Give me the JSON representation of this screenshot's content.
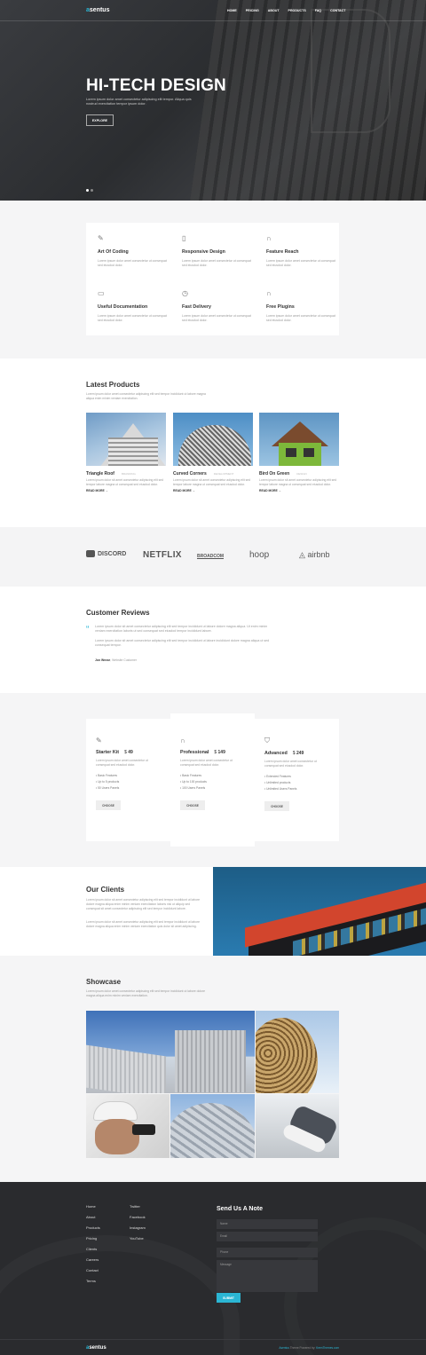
{
  "brand": {
    "logo_accent": "a",
    "logo_rest": "sentus",
    "accent_color": "#2bb6d4"
  },
  "nav": [
    "HOME",
    "PRICING",
    "ABOUT",
    "PRODUCTS",
    "FAQ",
    "CONTACT"
  ],
  "hero": {
    "title": "HI-TECH DESIGN",
    "text": "Lorem ipsum dolor amet consectetur adipiscing elit tempor. Aliqua quis nostrud exercitation tempor ipsum dolor.",
    "button": "EXPLORE"
  },
  "features": [
    {
      "icon": "pen-icon",
      "title": "Art Of Coding",
      "text": "Lorem ipsum dolor amet consectetur ut consequat sed eiusdod dolor."
    },
    {
      "icon": "mobile-icon",
      "title": "Responsive Design",
      "text": "Lorem ipsum dolor amet consectetur ut consequat sed eiusdod dolor."
    },
    {
      "icon": "headphones-icon",
      "title": "Feature Reach",
      "text": "Lorem ipsum dolor amet consectetur ut consequat sed eiusdod dolor."
    },
    {
      "icon": "book-icon",
      "title": "Useful Documentation",
      "text": "Lorem ipsum dolor amet consectetur ut consequat sed eiusdod dolor."
    },
    {
      "icon": "clock-icon",
      "title": "Fast Delivery",
      "text": "Lorem ipsum dolor amet consectetur ut consequat sed eiusdod dolor."
    },
    {
      "icon": "headset-icon",
      "title": "Free Plugins",
      "text": "Lorem ipsum dolor amet consectetur ut consequat sed eiusdod dolor."
    }
  ],
  "products": {
    "title": "Latest Products",
    "desc": "Lorem ipsum dolor amet consectetur adipiscing elit sed tempor incididunt ut labore magna aliqua enim minim veniam exercitation.",
    "items": [
      {
        "name": "Triangle Roof",
        "tag": "BRANDING",
        "text": "Lorem ipsum dolor sit amet consectetur adipiscing elit sed tempor labore magna ut consequat sed eiusdod dolor.",
        "more": "READ MORE →"
      },
      {
        "name": "Curved Corners",
        "tag": "DEVELOPMENT",
        "text": "Lorem ipsum dolor sit amet consectetur adipiscing elit sed tempor labore magna ut consequat sed eiusdod dolor.",
        "more": "READ MORE →"
      },
      {
        "name": "Bird On Green",
        "tag": "DESIGN",
        "text": "Lorem ipsum dolor sit amet consectetur adipiscing elit sed tempor labore magna ut consequat sed eiusdod dolor.",
        "more": "READ MORE →"
      }
    ]
  },
  "logos": [
    "DISCORD",
    "NETFLIX",
    "BROADCOM",
    "hoop",
    "airbnb"
  ],
  "reviews": {
    "title": "Customer Reviews",
    "p1": "Lorem ipsum dolor sit amet consectetur adipiscing elit sed tempor incididunt ut labore dolore magna aliqua. Ut enim minim veniam exercitation laboris ut sed consequat sed eiusdod tempor incididunt labore.",
    "p2": "Lorem ipsum dolor sit amet consectetur adipiscing elit sed tempor incididunt ut labore incididunt dolore magna aliqua ut sed consequat tempor.",
    "author": "Jon Wrose",
    "role": "Website Customer"
  },
  "pricing": [
    {
      "icon": "pen-icon",
      "name": "Starter Kit",
      "price": "49",
      "desc": "Lorem ipsum dolor amet consectetur ut consequat sed eiusdod dolor.",
      "items": [
        "Basic Features",
        "Up to 5 products",
        "50 Users Panels"
      ],
      "button": "CHOOSE"
    },
    {
      "icon": "headset-icon",
      "name": "Professional",
      "price": "149",
      "desc": "Lorem ipsum dolor amet consectetur ut consequat sed eiusdod dolor.",
      "items": [
        "Basic Features",
        "Up to 100 products",
        "100 Users Panels"
      ],
      "button": "CHOOSE"
    },
    {
      "icon": "shield-icon",
      "name": "Advanced",
      "price": "249",
      "desc": "Lorem ipsum dolor amet consectetur ut consequat sed eiusdod dolor.",
      "items": [
        "Extended Features",
        "Unlimited products",
        "Unlimited Users Panels"
      ],
      "button": "CHOOSE"
    }
  ],
  "clients": {
    "title": "Our Clients",
    "p1": "Lorem ipsum dolor sit amet consectetur adipiscing elit sed tempor incididunt ut labore dolore magna aliqua enim minim veniam exercitation laboris nisi ut aliquip sed consequat sit amet consectetur adipiscing elit sed tempor incididunt labore.",
    "p2": "Lorem ipsum dolor sit amet consectetur adipiscing elit sed tempor incididunt ut labore dolore magna aliqua enim minim veniam exercitation quis dolor sit amet adipiscing."
  },
  "showcase": {
    "title": "Showcase",
    "desc": "Lorem ipsum dolor amet consectetur adipiscing elit sed tempor incididunt ut labore dolore magna aliqua enim minim veniam exercitation."
  },
  "footer": {
    "col1": [
      "Home",
      "About",
      "Products",
      "Pricing",
      "Clients",
      "Careers",
      "Contact",
      "Terms"
    ],
    "col2": [
      "Twitter",
      "Facebook",
      "Instagram",
      "YouTube"
    ],
    "form_title": "Send Us A Note",
    "name_ph": "Name",
    "email_ph": "Email",
    "phone_ph": "Phone",
    "message_ph": "Message",
    "submit": "SUBMIT",
    "credit_brand": "Asentus",
    "credit_text": "Theme Powered by:",
    "credit_link": "KeenThemes.com"
  }
}
